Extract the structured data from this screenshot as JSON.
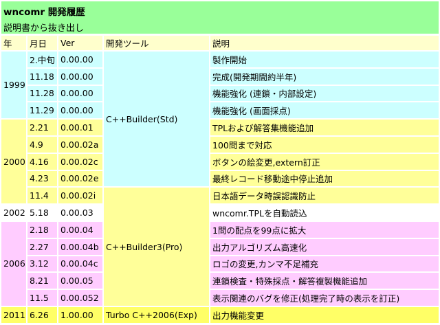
{
  "header": {
    "title": "wncomr 開発履歴",
    "subtitle": "説明書から抜き出し"
  },
  "columns": [
    "年",
    "月日",
    "Ver",
    "開発ツール",
    "説明"
  ],
  "tools": [
    "C++Builder(Std)",
    "C++Builder3(Pro)",
    "Turbo C++2006(Exp)"
  ],
  "years": [
    "1999",
    "2000",
    "2002",
    "2006",
    "2011"
  ],
  "rows": [
    {
      "date": "2.中旬",
      "ver": "0.00.00",
      "desc": "製作開始"
    },
    {
      "date": "11.18",
      "ver": "0.00.00",
      "desc": "完成(開発期間約半年)"
    },
    {
      "date": "11.28",
      "ver": "0.00.00",
      "desc": "機能強化 (連鎖・内部設定)"
    },
    {
      "date": "11.29",
      "ver": "0.00.00",
      "desc": "機能強化 (画面採点)"
    },
    {
      "date": "2.21",
      "ver": "0.00.01",
      "desc": "TPLおよび解答集機能追加"
    },
    {
      "date": "4.9",
      "ver": "0.00.02a",
      "desc": "100問まで対応"
    },
    {
      "date": "4.16",
      "ver": "0.00.02c",
      "desc": "ボタンの絵変更,extern訂正"
    },
    {
      "date": "4.23",
      "ver": "0.00.02e",
      "desc": "最終レコード移動途中停止追加"
    },
    {
      "date": "11.4",
      "ver": "0.00.02i",
      "desc": "日本語データ時誤認識防止"
    },
    {
      "date": "5.18",
      "ver": "0.00.03",
      "desc": "wncomr.TPLを自動読込"
    },
    {
      "date": "2.18",
      "ver": "0.00.04",
      "desc": "1問の配点を99点に拡大"
    },
    {
      "date": "2.27",
      "ver": "0.00.04b",
      "desc": "出力アルゴリズム高速化"
    },
    {
      "date": "3.12",
      "ver": "0.00.04c",
      "desc": "ロゴの変更,カンマ不足補充"
    },
    {
      "date": "8.21",
      "ver": "0.00.05",
      "desc": "連鎖検査・特殊採点・解答複製機能追加"
    },
    {
      "date": "11.5",
      "ver": "0.00.052",
      "desc": "表示関連のバグを修正(処理完了時の表示を訂正)"
    },
    {
      "date": "6.26",
      "ver": "1.00.00",
      "desc": "出力機能変更"
    }
  ],
  "colors": {
    "header": "#99ff99",
    "colhead": "#ffffcc",
    "y1999": "#ccffff",
    "y2000": "#ffff99",
    "y2002": "#ffffff",
    "y2006": "#ffccff",
    "y2011": "#ffff66"
  }
}
